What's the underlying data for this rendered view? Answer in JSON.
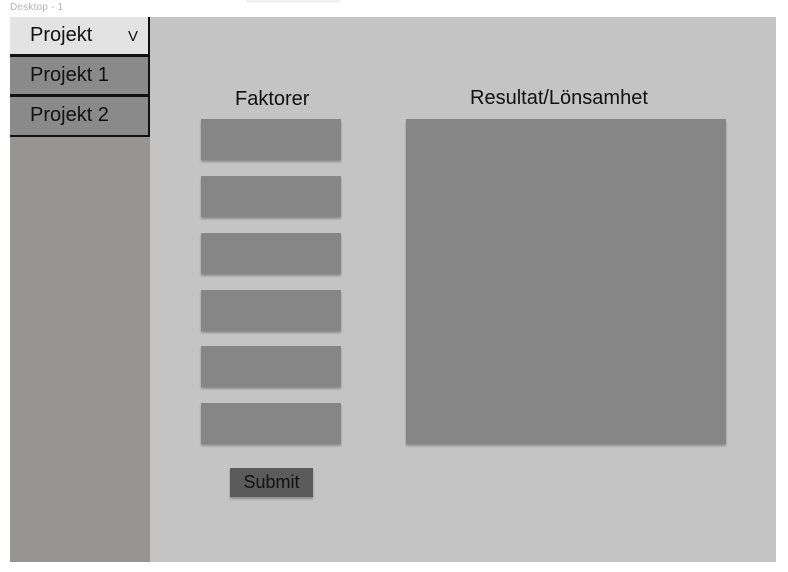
{
  "frame": {
    "label": "Desktop - 1"
  },
  "sidebar": {
    "dropdown": {
      "label": "Projekt",
      "chevron": "V"
    },
    "items": [
      {
        "label": "Projekt 1"
      },
      {
        "label": "Projekt 2"
      }
    ]
  },
  "main": {
    "factors_heading": "Faktorer",
    "factor_fields": [
      {
        "value": ""
      },
      {
        "value": ""
      },
      {
        "value": ""
      },
      {
        "value": ""
      },
      {
        "value": ""
      },
      {
        "value": ""
      }
    ],
    "result_heading": "Resultat/Lönsamhet",
    "submit_label": "Submit"
  },
  "colors": {
    "background": "#c4c4c4",
    "sidebar": "#969594",
    "field": "#868686",
    "button": "#5b5b5b",
    "dropdown": "#e3e3e3"
  }
}
